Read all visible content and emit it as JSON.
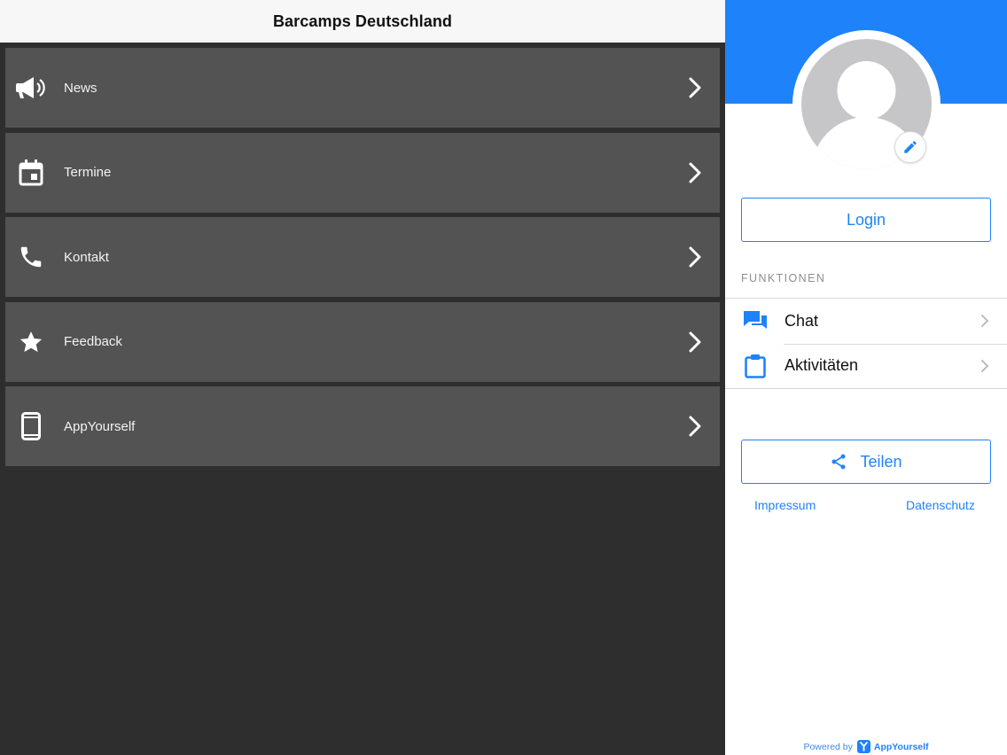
{
  "colors": {
    "accent": "#1e83fa",
    "menu_item_bg": "#545354",
    "left_bg": "#2f2e2f",
    "topbar_bg": "#f7f7f8",
    "avatar_gray": "#c6c6c8"
  },
  "topbar": {
    "title": "Barcamps Deutschland"
  },
  "menu": {
    "items": [
      {
        "label": "News",
        "icon": "megaphone-icon"
      },
      {
        "label": "Termine",
        "icon": "calendar-icon"
      },
      {
        "label": "Kontakt",
        "icon": "phone-icon"
      },
      {
        "label": "Feedback",
        "icon": "star-icon"
      },
      {
        "label": "AppYourself",
        "icon": "smartphone-icon"
      }
    ]
  },
  "drawer": {
    "avatar_icon": "user-avatar-placeholder",
    "edit_icon": "pencil-icon",
    "login_label": "Login",
    "section_label": "FUNKTIONEN",
    "functions": [
      {
        "label": "Chat",
        "icon": "chat-bubbles-icon"
      },
      {
        "label": "Aktivitäten",
        "icon": "clipboard-icon"
      }
    ],
    "share_label": "Teilen",
    "share_icon": "share-icon",
    "links": {
      "impressum": "Impressum",
      "datenschutz": "Datenschutz"
    },
    "powered_by": {
      "prefix": "Powered by",
      "brand": "AppYourself"
    }
  }
}
